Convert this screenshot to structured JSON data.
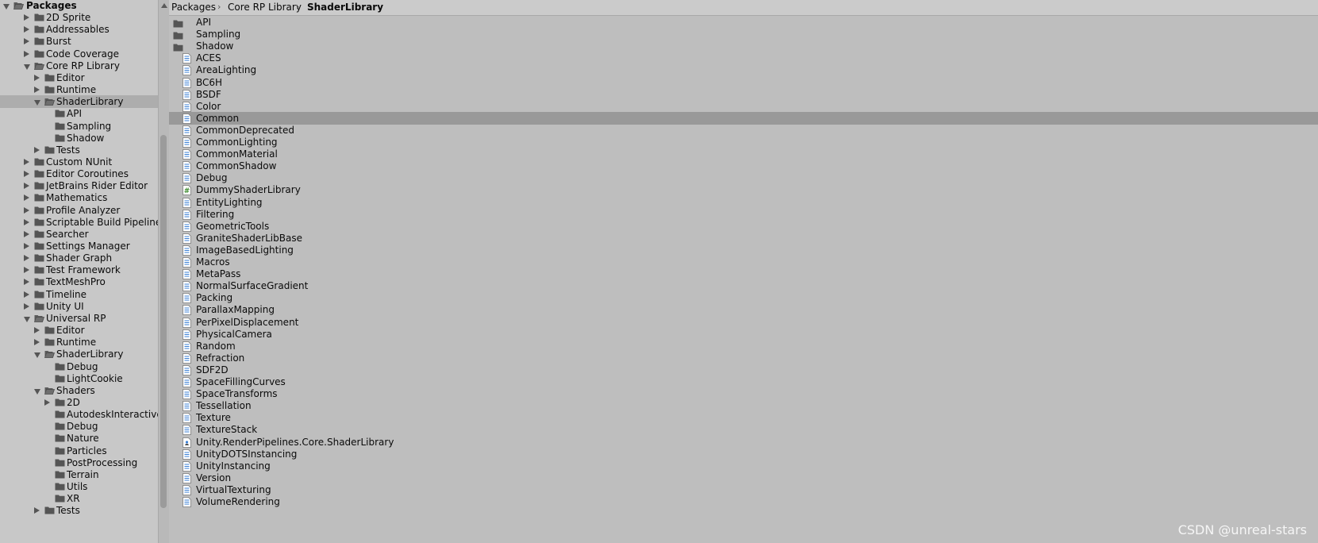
{
  "tree": [
    {
      "label": "Packages",
      "depth": 0,
      "expander": "open",
      "icon": "folder-open",
      "bold": true
    },
    {
      "label": "2D Sprite",
      "depth": 1,
      "expander": "closed",
      "icon": "folder"
    },
    {
      "label": "Addressables",
      "depth": 1,
      "expander": "closed",
      "icon": "folder"
    },
    {
      "label": "Burst",
      "depth": 1,
      "expander": "closed",
      "icon": "folder"
    },
    {
      "label": "Code Coverage",
      "depth": 1,
      "expander": "closed",
      "icon": "folder"
    },
    {
      "label": "Core RP Library",
      "depth": 1,
      "expander": "open",
      "icon": "folder-open"
    },
    {
      "label": "Editor",
      "depth": 2,
      "expander": "closed",
      "icon": "folder"
    },
    {
      "label": "Runtime",
      "depth": 2,
      "expander": "closed",
      "icon": "folder"
    },
    {
      "label": "ShaderLibrary",
      "depth": 2,
      "expander": "open",
      "icon": "folder-open",
      "selected": true
    },
    {
      "label": "API",
      "depth": 3,
      "expander": "none",
      "icon": "folder"
    },
    {
      "label": "Sampling",
      "depth": 3,
      "expander": "none",
      "icon": "folder"
    },
    {
      "label": "Shadow",
      "depth": 3,
      "expander": "none",
      "icon": "folder"
    },
    {
      "label": "Tests",
      "depth": 2,
      "expander": "closed",
      "icon": "folder"
    },
    {
      "label": "Custom NUnit",
      "depth": 1,
      "expander": "closed",
      "icon": "folder"
    },
    {
      "label": "Editor Coroutines",
      "depth": 1,
      "expander": "closed",
      "icon": "folder"
    },
    {
      "label": "JetBrains Rider Editor",
      "depth": 1,
      "expander": "closed",
      "icon": "folder"
    },
    {
      "label": "Mathematics",
      "depth": 1,
      "expander": "closed",
      "icon": "folder"
    },
    {
      "label": "Profile Analyzer",
      "depth": 1,
      "expander": "closed",
      "icon": "folder"
    },
    {
      "label": "Scriptable Build Pipeline",
      "depth": 1,
      "expander": "closed",
      "icon": "folder"
    },
    {
      "label": "Searcher",
      "depth": 1,
      "expander": "closed",
      "icon": "folder"
    },
    {
      "label": "Settings Manager",
      "depth": 1,
      "expander": "closed",
      "icon": "folder"
    },
    {
      "label": "Shader Graph",
      "depth": 1,
      "expander": "closed",
      "icon": "folder"
    },
    {
      "label": "Test Framework",
      "depth": 1,
      "expander": "closed",
      "icon": "folder"
    },
    {
      "label": "TextMeshPro",
      "depth": 1,
      "expander": "closed",
      "icon": "folder"
    },
    {
      "label": "Timeline",
      "depth": 1,
      "expander": "closed",
      "icon": "folder"
    },
    {
      "label": "Unity UI",
      "depth": 1,
      "expander": "closed",
      "icon": "folder"
    },
    {
      "label": "Universal RP",
      "depth": 1,
      "expander": "open",
      "icon": "folder-open"
    },
    {
      "label": "Editor",
      "depth": 2,
      "expander": "closed",
      "icon": "folder"
    },
    {
      "label": "Runtime",
      "depth": 2,
      "expander": "closed",
      "icon": "folder"
    },
    {
      "label": "ShaderLibrary",
      "depth": 2,
      "expander": "open",
      "icon": "folder-open"
    },
    {
      "label": "Debug",
      "depth": 3,
      "expander": "none",
      "icon": "folder"
    },
    {
      "label": "LightCookie",
      "depth": 3,
      "expander": "none",
      "icon": "folder"
    },
    {
      "label": "Shaders",
      "depth": 2,
      "expander": "open",
      "icon": "folder-open"
    },
    {
      "label": "2D",
      "depth": 3,
      "expander": "closed",
      "icon": "folder"
    },
    {
      "label": "AutodeskInteractive",
      "depth": 3,
      "expander": "none",
      "icon": "folder"
    },
    {
      "label": "Debug",
      "depth": 3,
      "expander": "none",
      "icon": "folder"
    },
    {
      "label": "Nature",
      "depth": 3,
      "expander": "none",
      "icon": "folder"
    },
    {
      "label": "Particles",
      "depth": 3,
      "expander": "none",
      "icon": "folder"
    },
    {
      "label": "PostProcessing",
      "depth": 3,
      "expander": "none",
      "icon": "folder"
    },
    {
      "label": "Terrain",
      "depth": 3,
      "expander": "none",
      "icon": "folder"
    },
    {
      "label": "Utils",
      "depth": 3,
      "expander": "none",
      "icon": "folder"
    },
    {
      "label": "XR",
      "depth": 3,
      "expander": "none",
      "icon": "folder"
    },
    {
      "label": "Tests",
      "depth": 2,
      "expander": "closed",
      "icon": "folder"
    }
  ],
  "breadcrumb": [
    "Packages",
    "Core RP Library",
    "ShaderLibrary"
  ],
  "files": [
    {
      "label": "API",
      "icon": "folder"
    },
    {
      "label": "Sampling",
      "icon": "folder"
    },
    {
      "label": "Shadow",
      "icon": "folder"
    },
    {
      "label": "ACES",
      "icon": "shader-file"
    },
    {
      "label": "AreaLighting",
      "icon": "shader-file"
    },
    {
      "label": "BC6H",
      "icon": "shader-file"
    },
    {
      "label": "BSDF",
      "icon": "shader-file"
    },
    {
      "label": "Color",
      "icon": "shader-file"
    },
    {
      "label": "Common",
      "icon": "shader-file",
      "selected": true
    },
    {
      "label": "CommonDeprecated",
      "icon": "shader-file"
    },
    {
      "label": "CommonLighting",
      "icon": "shader-file"
    },
    {
      "label": "CommonMaterial",
      "icon": "shader-file"
    },
    {
      "label": "CommonShadow",
      "icon": "shader-file"
    },
    {
      "label": "Debug",
      "icon": "shader-file"
    },
    {
      "label": "DummyShaderLibrary",
      "icon": "csharp-file"
    },
    {
      "label": "EntityLighting",
      "icon": "shader-file"
    },
    {
      "label": "Filtering",
      "icon": "shader-file"
    },
    {
      "label": "GeometricTools",
      "icon": "shader-file"
    },
    {
      "label": "GraniteShaderLibBase",
      "icon": "shader-file"
    },
    {
      "label": "ImageBasedLighting",
      "icon": "shader-file"
    },
    {
      "label": "Macros",
      "icon": "shader-file"
    },
    {
      "label": "MetaPass",
      "icon": "shader-file"
    },
    {
      "label": "NormalSurfaceGradient",
      "icon": "shader-file"
    },
    {
      "label": "Packing",
      "icon": "shader-file"
    },
    {
      "label": "ParallaxMapping",
      "icon": "shader-file"
    },
    {
      "label": "PerPixelDisplacement",
      "icon": "shader-file"
    },
    {
      "label": "PhysicalCamera",
      "icon": "shader-file"
    },
    {
      "label": "Random",
      "icon": "shader-file"
    },
    {
      "label": "Refraction",
      "icon": "shader-file"
    },
    {
      "label": "SDF2D",
      "icon": "shader-file"
    },
    {
      "label": "SpaceFillingCurves",
      "icon": "shader-file"
    },
    {
      "label": "SpaceTransforms",
      "icon": "shader-file"
    },
    {
      "label": "Tessellation",
      "icon": "shader-file"
    },
    {
      "label": "Texture",
      "icon": "shader-file"
    },
    {
      "label": "TextureStack",
      "icon": "shader-file"
    },
    {
      "label": "Unity.RenderPipelines.Core.ShaderLibrary",
      "icon": "assembly-definition-file"
    },
    {
      "label": "UnityDOTSInstancing",
      "icon": "shader-file"
    },
    {
      "label": "UnityInstancing",
      "icon": "shader-file"
    },
    {
      "label": "Version",
      "icon": "shader-file"
    },
    {
      "label": "VirtualTexturing",
      "icon": "shader-file"
    },
    {
      "label": "VolumeRendering",
      "icon": "shader-file"
    }
  ],
  "watermark": "CSDN @unreal-stars",
  "colors": {
    "selection_tree": "#adadad",
    "selection_list": "#999999",
    "shader_icon_lines": "#3a7fd5",
    "folder": "#5b5b5b"
  }
}
